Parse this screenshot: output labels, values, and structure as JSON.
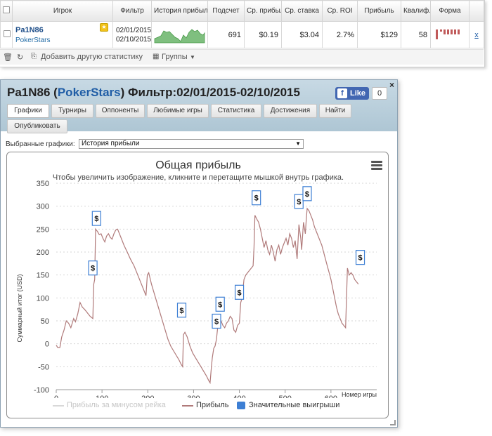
{
  "stats_table": {
    "headers": [
      "",
      "Игрок",
      "Фильтр",
      "История прибыли",
      "Подсчет",
      "Ср. прибыль",
      "Ср. ставка",
      "Ср. ROI",
      "Прибыль",
      "Квалиф.",
      "Форма",
      ""
    ],
    "row": {
      "player_name": "Pa1N86",
      "player_site": "PokerStars",
      "filter_line1": "02/01/2015",
      "filter_line2": "02/10/2015",
      "count": "691",
      "avg_profit": "$0.19",
      "avg_stake": "$3.04",
      "avg_roi": "2.7%",
      "profit": "$129",
      "qualify": "58",
      "remove_label": "x"
    },
    "toolbar": {
      "add_stats": "Добавить другую статистику",
      "groups": "Группы"
    }
  },
  "popup": {
    "title_player": "Pa1N86",
    "title_site": "PokerStars",
    "title_filter": "Фильтр:02/01/2015-02/10/2015",
    "like_label": "Like",
    "like_count": "0",
    "close_label": "×",
    "tabs": [
      "Графики",
      "Турниры",
      "Оппоненты",
      "Любимые игры",
      "Статистика",
      "Достижения",
      "Найти",
      "Опубликовать"
    ],
    "select_label": "Выбранные графики:",
    "select_value": "История прибыли"
  },
  "chart_data": {
    "type": "line",
    "title": "Общая прибыль",
    "subtitle": "Чтобы увеличить изображение, кликните и перетащите мышкой внутрь графика.",
    "ylabel": "Суммарный итог (USD)",
    "xlabel": "Номер игры",
    "xlim": [
      0,
      700
    ],
    "ylim": [
      -100,
      350
    ],
    "x_ticks": [
      0,
      100,
      200,
      300,
      400,
      500,
      600
    ],
    "y_ticks": [
      -100,
      -50,
      0,
      50,
      100,
      150,
      200,
      250,
      300,
      350
    ],
    "grid": true,
    "legend_position": "bottom",
    "series": [
      {
        "name": "Прибыль за минусом рейка",
        "color": "#d0d0d0",
        "visible": false,
        "points": []
      },
      {
        "name": "Прибыль",
        "color": "#b07a7a",
        "visible": true,
        "points": [
          [
            0,
            -3
          ],
          [
            3,
            -8
          ],
          [
            8,
            -8
          ],
          [
            12,
            15
          ],
          [
            17,
            30
          ],
          [
            22,
            50
          ],
          [
            27,
            45
          ],
          [
            32,
            35
          ],
          [
            38,
            55
          ],
          [
            42,
            48
          ],
          [
            47,
            65
          ],
          [
            52,
            90
          ],
          [
            57,
            80
          ],
          [
            62,
            75
          ],
          [
            66,
            70
          ],
          [
            70,
            65
          ],
          [
            74,
            60
          ],
          [
            80,
            55
          ],
          [
            82,
            130
          ],
          [
            84,
            140
          ],
          [
            86,
            250
          ],
          [
            90,
            245
          ],
          [
            94,
            238
          ],
          [
            98,
            240
          ],
          [
            102,
            230
          ],
          [
            106,
            222
          ],
          [
            110,
            235
          ],
          [
            114,
            240
          ],
          [
            118,
            232
          ],
          [
            122,
            228
          ],
          [
            126,
            240
          ],
          [
            130,
            248
          ],
          [
            134,
            250
          ],
          [
            138,
            240
          ],
          [
            142,
            230
          ],
          [
            148,
            215
          ],
          [
            155,
            200
          ],
          [
            162,
            185
          ],
          [
            170,
            170
          ],
          [
            178,
            150
          ],
          [
            186,
            130
          ],
          [
            192,
            115
          ],
          [
            196,
            105
          ],
          [
            199,
            150
          ],
          [
            202,
            155
          ],
          [
            208,
            130
          ],
          [
            214,
            110
          ],
          [
            220,
            90
          ],
          [
            226,
            70
          ],
          [
            232,
            50
          ],
          [
            238,
            30
          ],
          [
            244,
            10
          ],
          [
            250,
            -5
          ],
          [
            256,
            -15
          ],
          [
            262,
            -25
          ],
          [
            268,
            -35
          ],
          [
            273,
            -45
          ],
          [
            276,
            -50
          ],
          [
            278,
            20
          ],
          [
            281,
            25
          ],
          [
            286,
            15
          ],
          [
            292,
            -5
          ],
          [
            298,
            -20
          ],
          [
            304,
            -30
          ],
          [
            310,
            -40
          ],
          [
            316,
            -50
          ],
          [
            322,
            -60
          ],
          [
            328,
            -70
          ],
          [
            333,
            -80
          ],
          [
            336,
            -85
          ],
          [
            339,
            -50
          ],
          [
            341,
            -30
          ],
          [
            344,
            -10
          ],
          [
            347,
            -5
          ],
          [
            350,
            10
          ],
          [
            353,
            40
          ],
          [
            356,
            55
          ],
          [
            360,
            50
          ],
          [
            364,
            40
          ],
          [
            368,
            35
          ],
          [
            372,
            45
          ],
          [
            376,
            50
          ],
          [
            380,
            60
          ],
          [
            384,
            55
          ],
          [
            388,
            30
          ],
          [
            392,
            25
          ],
          [
            396,
            40
          ],
          [
            400,
            45
          ],
          [
            403,
            90
          ],
          [
            406,
            100
          ],
          [
            410,
            140
          ],
          [
            414,
            150
          ],
          [
            418,
            155
          ],
          [
            422,
            160
          ],
          [
            426,
            165
          ],
          [
            430,
            170
          ],
          [
            432,
            210
          ],
          [
            434,
            280
          ],
          [
            438,
            272
          ],
          [
            442,
            265
          ],
          [
            446,
            250
          ],
          [
            450,
            230
          ],
          [
            454,
            210
          ],
          [
            458,
            225
          ],
          [
            462,
            205
          ],
          [
            466,
            195
          ],
          [
            470,
            215
          ],
          [
            474,
            200
          ],
          [
            478,
            180
          ],
          [
            482,
            205
          ],
          [
            486,
            215
          ],
          [
            490,
            195
          ],
          [
            494,
            210
          ],
          [
            498,
            220
          ],
          [
            502,
            230
          ],
          [
            506,
            215
          ],
          [
            510,
            240
          ],
          [
            514,
            230
          ],
          [
            518,
            210
          ],
          [
            522,
            225
          ],
          [
            526,
            185
          ],
          [
            530,
            260
          ],
          [
            534,
            230
          ],
          [
            536,
            205
          ],
          [
            540,
            265
          ],
          [
            544,
            240
          ],
          [
            546,
            270
          ],
          [
            548,
            295
          ],
          [
            552,
            290
          ],
          [
            556,
            280
          ],
          [
            560,
            270
          ],
          [
            564,
            255
          ],
          [
            568,
            245
          ],
          [
            572,
            235
          ],
          [
            576,
            225
          ],
          [
            580,
            215
          ],
          [
            584,
            200
          ],
          [
            588,
            185
          ],
          [
            592,
            170
          ],
          [
            596,
            155
          ],
          [
            600,
            140
          ],
          [
            604,
            120
          ],
          [
            608,
            100
          ],
          [
            612,
            80
          ],
          [
            616,
            65
          ],
          [
            620,
            55
          ],
          [
            624,
            45
          ],
          [
            628,
            40
          ],
          [
            632,
            35
          ],
          [
            636,
            165
          ],
          [
            640,
            150
          ],
          [
            644,
            155
          ],
          [
            648,
            150
          ],
          [
            652,
            140
          ],
          [
            656,
            135
          ],
          [
            660,
            130
          ]
        ]
      }
    ],
    "markers": {
      "name": "Значительные выигрыши",
      "color": "#3d7fd4",
      "points": [
        [
          80,
          150
        ],
        [
          88,
          258
        ],
        [
          274,
          58
        ],
        [
          350,
          34
        ],
        [
          358,
          71
        ],
        [
          400,
          97
        ],
        [
          437,
          303
        ],
        [
          530,
          295
        ],
        [
          548,
          312
        ],
        [
          664,
          173
        ]
      ]
    }
  }
}
